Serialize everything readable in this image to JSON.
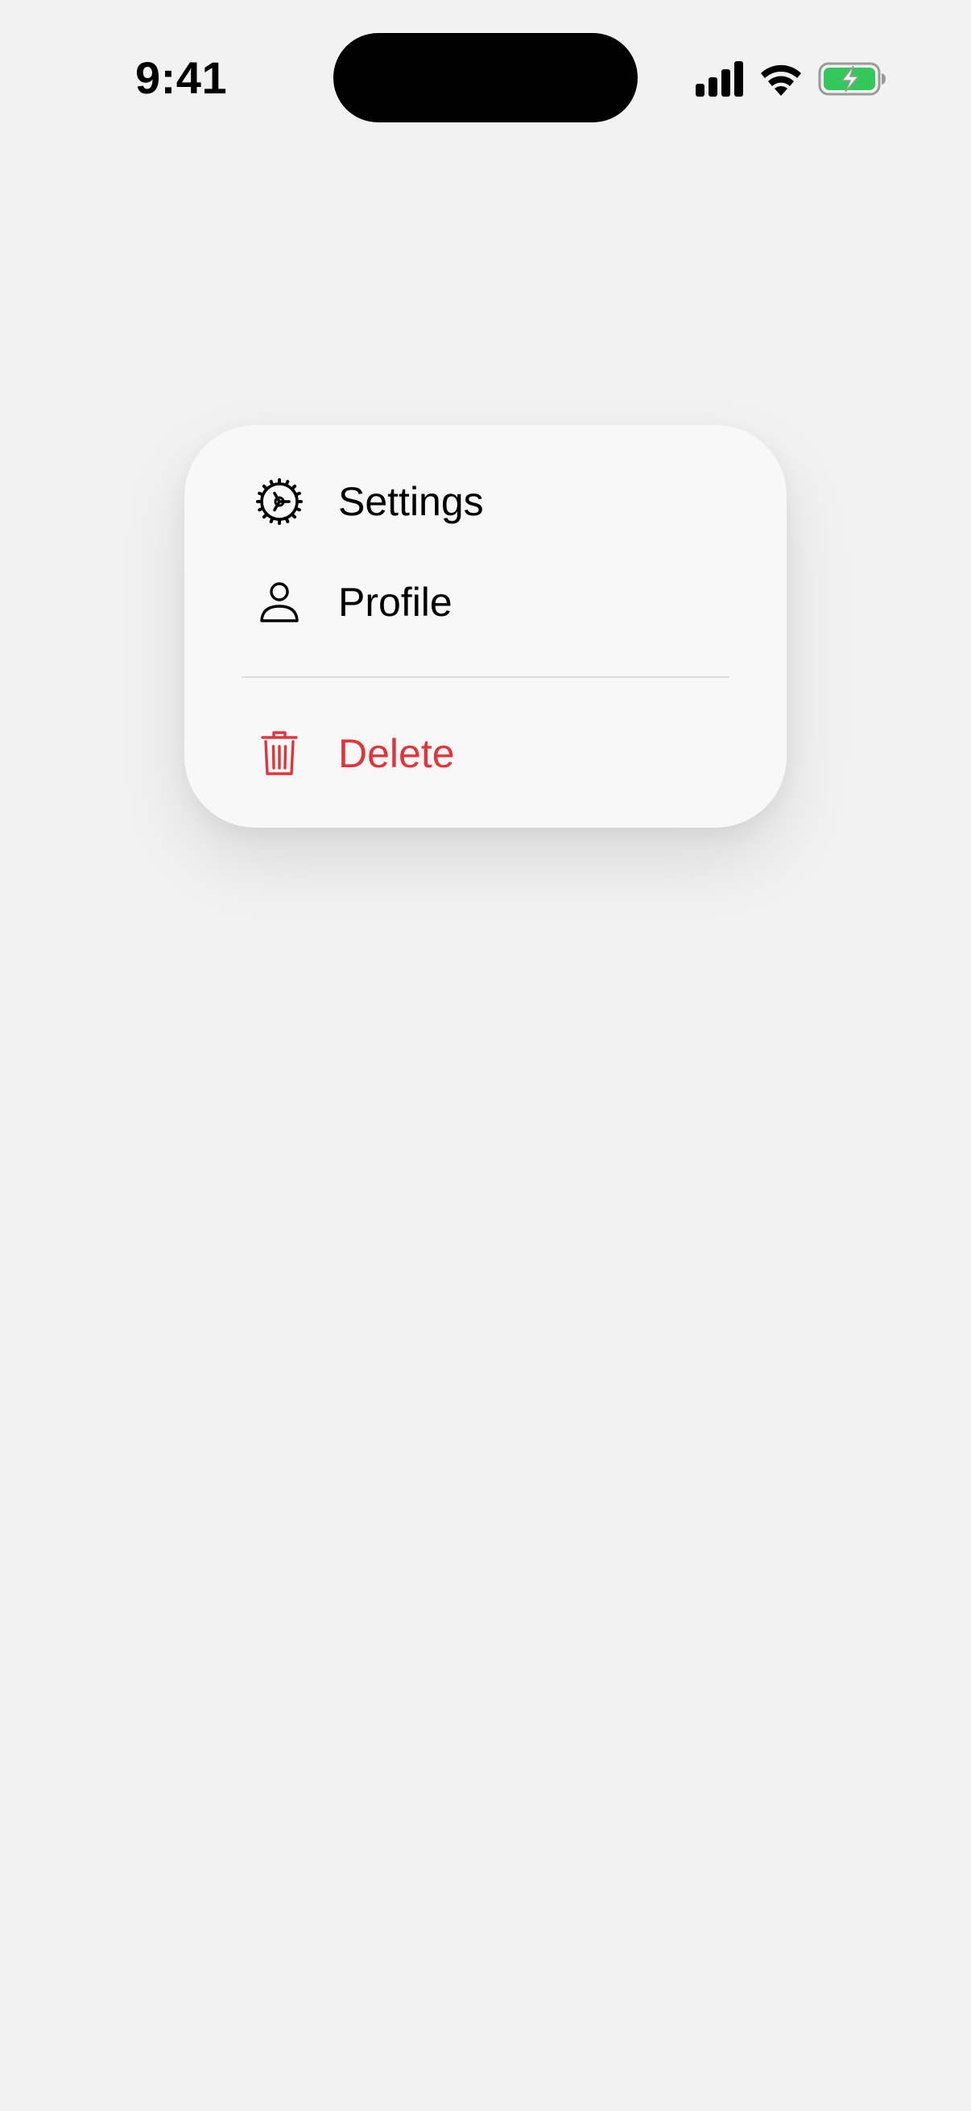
{
  "status_bar": {
    "time": "9:41",
    "icons": [
      "cellular-signal-icon",
      "wifi-icon",
      "battery-charging-icon"
    ],
    "battery_color": "#34c759"
  },
  "menu": {
    "items": [
      {
        "label": "Settings",
        "icon": "gear-icon",
        "color": "#000000"
      },
      {
        "label": "Profile",
        "icon": "person-icon",
        "color": "#000000"
      },
      {
        "label": "Delete",
        "icon": "trash-icon",
        "color": "#e0353b",
        "destructive": true
      }
    ]
  }
}
